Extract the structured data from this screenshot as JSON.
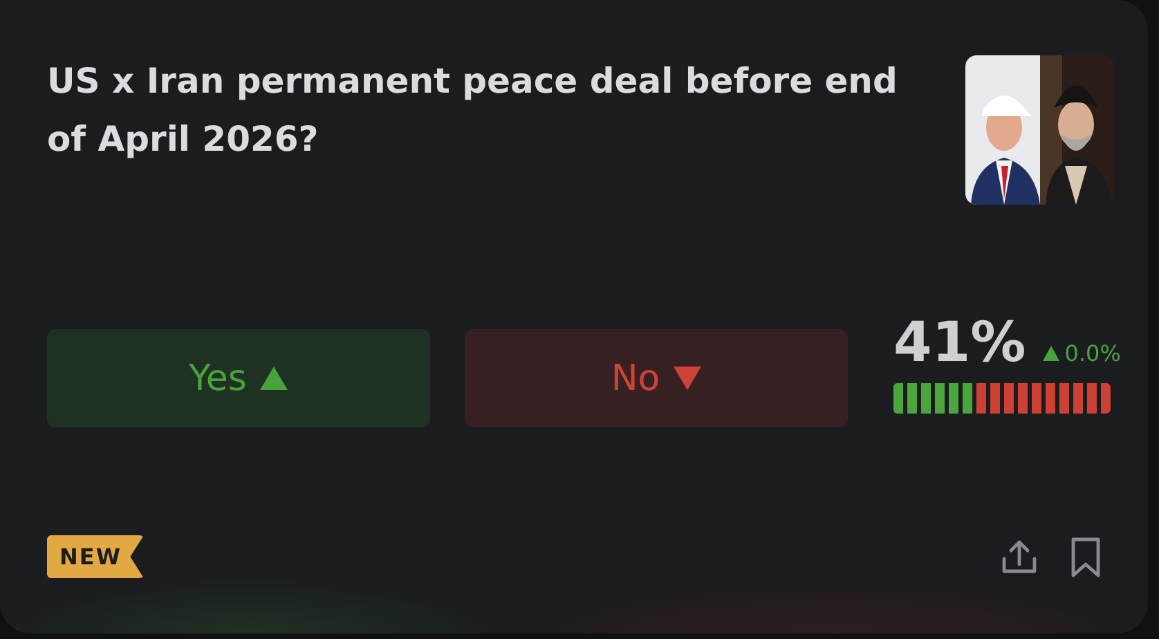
{
  "market": {
    "title": "US x Iran permanent peace deal before end of April 2026?"
  },
  "outcomes": [
    {
      "kind": "yes",
      "label": "Yes"
    },
    {
      "kind": "no",
      "label": "No"
    }
  ],
  "odds": {
    "percent": "41%",
    "change": "0.0%",
    "rising": true,
    "level": 0.375
  },
  "badge": "NEW"
}
